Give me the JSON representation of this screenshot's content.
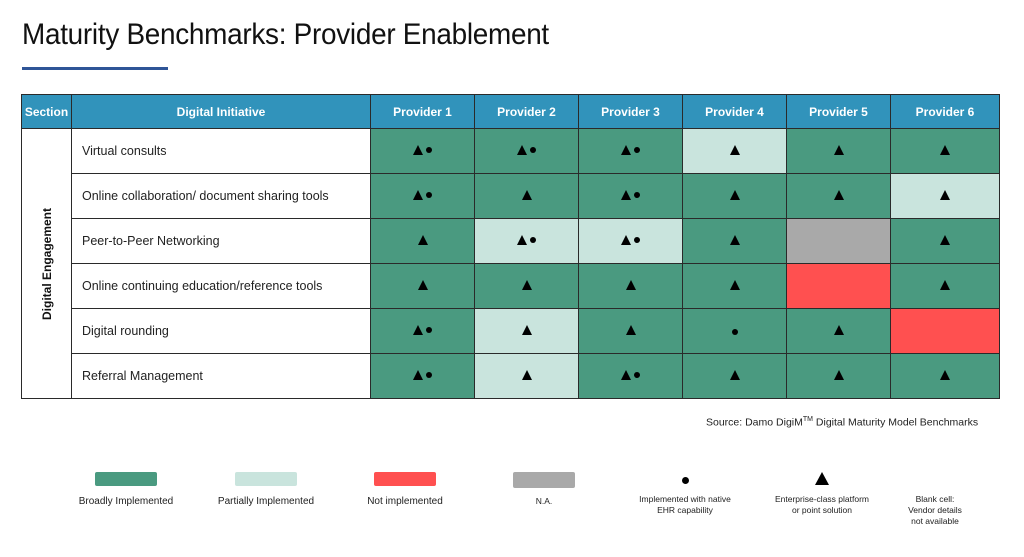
{
  "title": "Maturity Benchmarks: Provider Enablement",
  "colors": {
    "accent_rule": "#2f5597",
    "header_bg": "#3193bb",
    "broadly": "#4a9a80",
    "partially": "#c9e4dd",
    "not_implemented": "#ff5050",
    "na": "#a9a9a9"
  },
  "table": {
    "headers": {
      "section": "Section",
      "initiative": "Digital Initiative",
      "providers": [
        "Provider 1",
        "Provider 2",
        "Provider 3",
        "Provider 4",
        "Provider 5",
        "Provider 6"
      ]
    },
    "section_label": "Digital Engagement",
    "rows": [
      {
        "initiative": "Virtual consults",
        "cells": [
          {
            "status": "broadly",
            "symbols": "triangle-dot"
          },
          {
            "status": "broadly",
            "symbols": "triangle-dot"
          },
          {
            "status": "broadly",
            "symbols": "triangle-dot"
          },
          {
            "status": "partially",
            "symbols": "triangle"
          },
          {
            "status": "broadly",
            "symbols": "triangle"
          },
          {
            "status": "broadly",
            "symbols": "triangle"
          }
        ]
      },
      {
        "initiative": "Online collaboration/ document sharing tools",
        "cells": [
          {
            "status": "broadly",
            "symbols": "triangle-dot"
          },
          {
            "status": "broadly",
            "symbols": "triangle"
          },
          {
            "status": "broadly",
            "symbols": "triangle-dot"
          },
          {
            "status": "broadly",
            "symbols": "triangle"
          },
          {
            "status": "broadly",
            "symbols": "triangle"
          },
          {
            "status": "partially",
            "symbols": "triangle"
          }
        ]
      },
      {
        "initiative": "Peer-to-Peer Networking",
        "cells": [
          {
            "status": "broadly",
            "symbols": "triangle"
          },
          {
            "status": "partially",
            "symbols": "triangle-dot"
          },
          {
            "status": "partially",
            "symbols": "triangle-dot"
          },
          {
            "status": "broadly",
            "symbols": "triangle"
          },
          {
            "status": "na",
            "symbols": "none"
          },
          {
            "status": "broadly",
            "symbols": "triangle"
          }
        ]
      },
      {
        "initiative": "Online continuing education/reference tools",
        "cells": [
          {
            "status": "broadly",
            "symbols": "triangle"
          },
          {
            "status": "broadly",
            "symbols": "triangle"
          },
          {
            "status": "broadly",
            "symbols": "triangle"
          },
          {
            "status": "broadly",
            "symbols": "triangle"
          },
          {
            "status": "not_implemented",
            "symbols": "none"
          },
          {
            "status": "broadly",
            "symbols": "triangle"
          }
        ]
      },
      {
        "initiative": "Digital rounding",
        "cells": [
          {
            "status": "broadly",
            "symbols": "triangle-dot"
          },
          {
            "status": "partially",
            "symbols": "triangle"
          },
          {
            "status": "broadly",
            "symbols": "triangle"
          },
          {
            "status": "broadly",
            "symbols": "dot"
          },
          {
            "status": "broadly",
            "symbols": "triangle"
          },
          {
            "status": "not_implemented",
            "symbols": "none"
          }
        ]
      },
      {
        "initiative": "Referral Management",
        "cells": [
          {
            "status": "broadly",
            "symbols": "triangle-dot"
          },
          {
            "status": "partially",
            "symbols": "triangle"
          },
          {
            "status": "broadly",
            "symbols": "triangle-dot"
          },
          {
            "status": "broadly",
            "symbols": "triangle"
          },
          {
            "status": "broadly",
            "symbols": "triangle"
          },
          {
            "status": "broadly",
            "symbols": "triangle"
          }
        ]
      }
    ]
  },
  "source": {
    "prefix": "Source: Damo DigiM",
    "tm": "TM",
    "suffix": " Digital Maturity Model Benchmarks"
  },
  "legend": {
    "broadly": "Broadly Implemented",
    "partially": "Partially Implemented",
    "not_implemented": "Not implemented",
    "na": "N.A.",
    "dot_line1": "Implemented with native",
    "dot_line2": "EHR capability",
    "tri_line1": "Enterprise-class platform",
    "tri_line2": "or point solution",
    "blank_line1": "Blank cell:",
    "blank_line2": "Vendor details",
    "blank_line3": "not available"
  }
}
